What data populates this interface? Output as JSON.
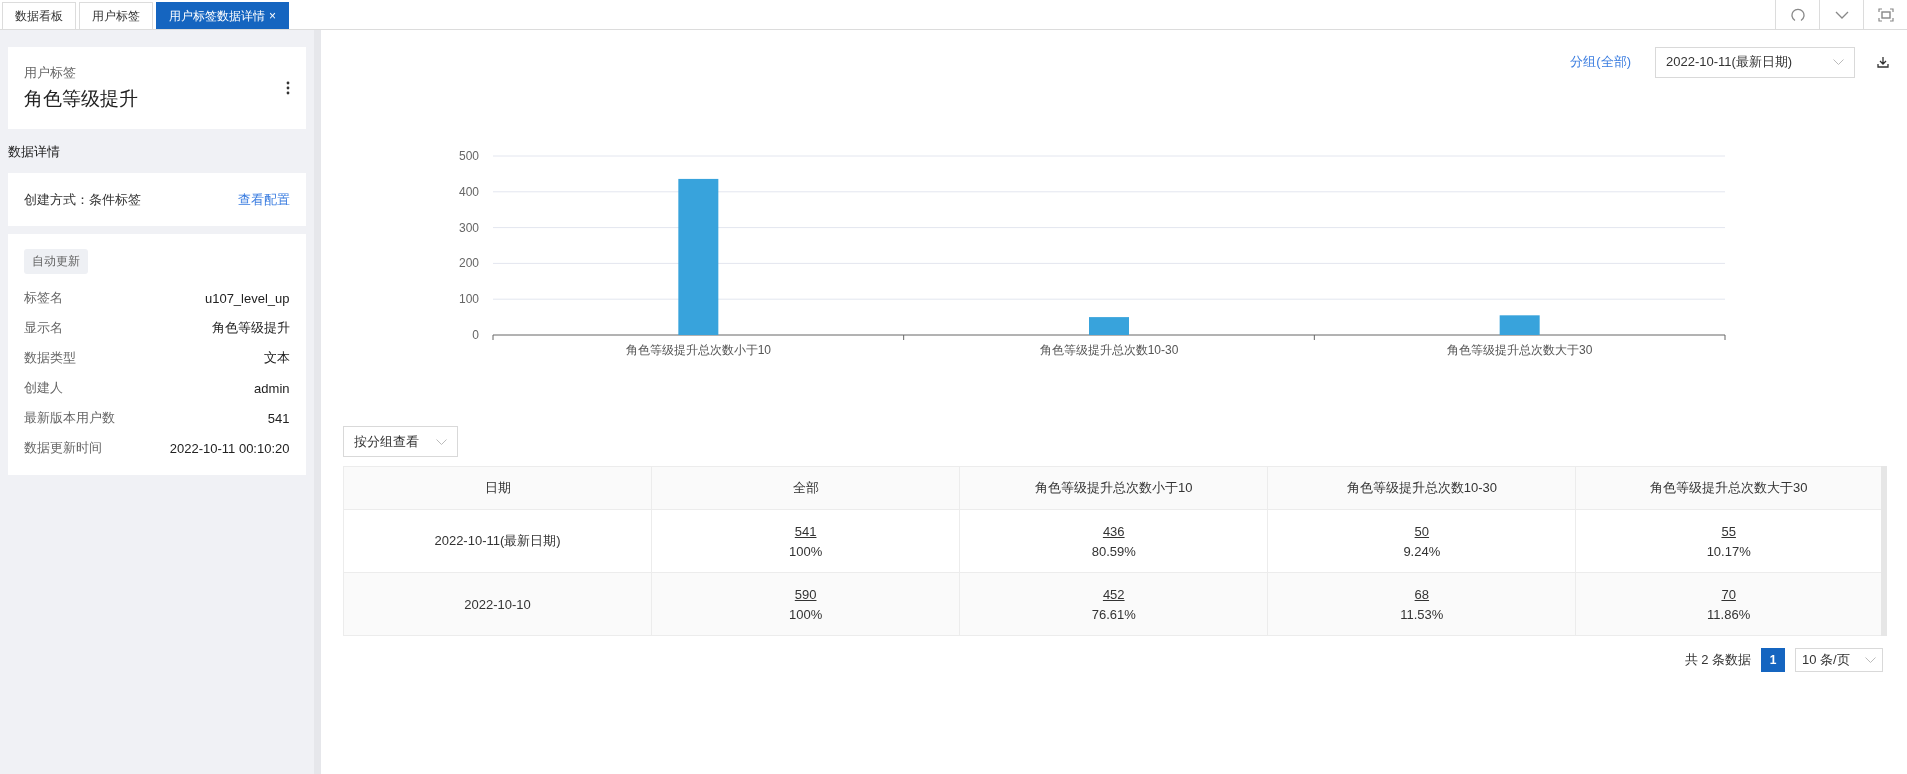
{
  "tabs": [
    {
      "label": "数据看板",
      "selected": false
    },
    {
      "label": "用户标签",
      "selected": false
    },
    {
      "label": "用户标签数据详情",
      "selected": true,
      "close": "×"
    }
  ],
  "sidebar": {
    "header": {
      "caption": "用户标签",
      "title": "角色等级提升"
    },
    "section_title": "数据详情",
    "creation": {
      "label": "创建方式：条件标签",
      "link": "查看配置"
    },
    "badge": "自动更新",
    "properties": [
      {
        "label": "标签名",
        "value": "u107_level_up"
      },
      {
        "label": "显示名",
        "value": "角色等级提升"
      },
      {
        "label": "数据类型",
        "value": "文本"
      },
      {
        "label": "创建人",
        "value": "admin"
      },
      {
        "label": "最新版本用户数",
        "value": "541"
      },
      {
        "label": "数据更新时间",
        "value": "2022-10-11 00:10:20"
      }
    ]
  },
  "toolbar": {
    "group_link": "分组(全部)",
    "date_select": "2022-10-11(最新日期)"
  },
  "chart": {
    "chart_data": {
      "type": "bar",
      "categories": [
        "角色等级提升总次数小于10",
        "角色等级提升总次数10-30",
        "角色等级提升总次数大于30"
      ],
      "values": [
        436,
        50,
        55
      ],
      "grid": true,
      "ylim": [
        0,
        500
      ],
      "yticks": [
        0,
        100,
        200,
        300,
        400,
        500
      ]
    }
  },
  "view_select": "按分组查看",
  "table": {
    "columns": [
      "日期",
      "全部",
      "角色等级提升总次数小于10",
      "角色等级提升总次数10-30",
      "角色等级提升总次数大于30"
    ],
    "rows": [
      {
        "cells": [
          {
            "text": "2022-10-11(最新日期)"
          },
          {
            "count": "541",
            "share": "100%"
          },
          {
            "count": "436",
            "share": "80.59%"
          },
          {
            "count": "50",
            "share": "9.24%"
          },
          {
            "count": "55",
            "share": "10.17%"
          }
        ]
      },
      {
        "cells": [
          {
            "text": "2022-10-10"
          },
          {
            "count": "590",
            "share": "100%"
          },
          {
            "count": "452",
            "share": "76.61%"
          },
          {
            "count": "68",
            "share": "11.53%"
          },
          {
            "count": "70",
            "share": "11.86%"
          }
        ]
      }
    ]
  },
  "pagination": {
    "total": "共 2 条数据",
    "pages": [
      {
        "label": "1",
        "selected": true
      }
    ],
    "page_size": "10 条/页"
  }
}
